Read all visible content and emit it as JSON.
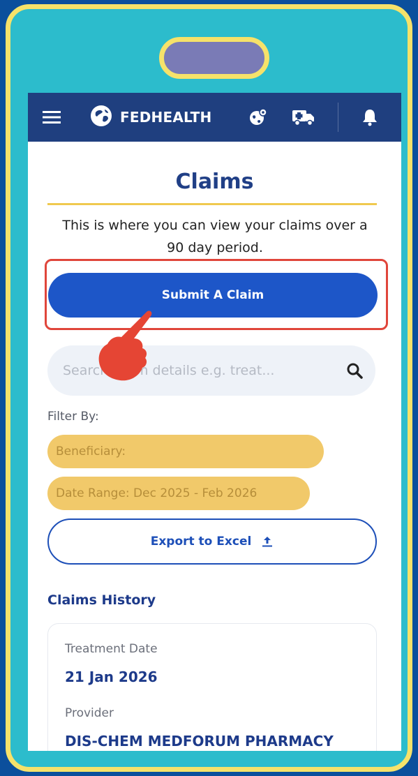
{
  "app": {
    "brand_name": "FEDHEALTH",
    "brand_color": "#1f3f7f",
    "accent_color": "#1d56c8",
    "highlight_color": "#e0463b",
    "chip_color": "#f1c96a"
  },
  "navbar": {
    "icons": [
      "hamburger-menu-icon",
      "fedhealth-logo-icon",
      "globe-location-icon",
      "ambulance-icon",
      "bell-icon"
    ]
  },
  "page": {
    "title": "Claims",
    "subtitle": "This is where you can view your claims over a 90 day period."
  },
  "actions": {
    "submit_label": "Submit A Claim",
    "export_label": "Export to Excel"
  },
  "search": {
    "placeholder": "Search claim details e.g. treat..."
  },
  "filters": {
    "label": "Filter By:",
    "beneficiary": "Beneficiary:",
    "date_range": "Date Range: Dec 2025 - Feb 2026"
  },
  "history": {
    "heading": "Claims History",
    "claims": [
      {
        "treatment_date_label": "Treatment Date",
        "treatment_date": "21 Jan 2026",
        "provider_label": "Provider",
        "provider": "DIS-CHEM MEDFORUM PHARMACY"
      }
    ]
  }
}
